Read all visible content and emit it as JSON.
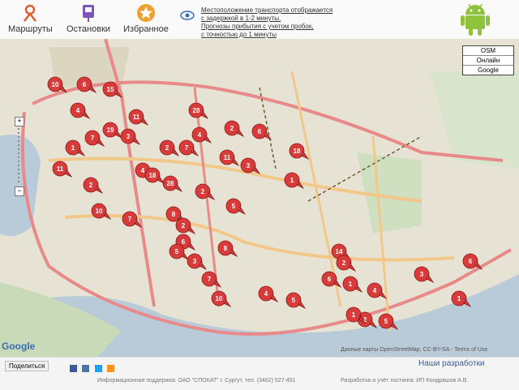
{
  "nav": {
    "routes": "Маршруты",
    "stops": "Остановки",
    "favorites": "Избранное"
  },
  "notice": {
    "line1": "Местоположение транспорта отображается",
    "line2": "с задержкой в 1-2 минуты.",
    "line3": "Прогнозы прибытия с учетом пробок,",
    "line4": "с точностью до 1 минуты"
  },
  "layers": [
    "OSM",
    "Онлайн",
    "Google"
  ],
  "map": {
    "markers": [
      "10",
      "6",
      "15",
      "4",
      "11",
      "28",
      "2",
      "1",
      "7",
      "19",
      "3",
      "2",
      "7",
      "4",
      "6",
      "11",
      "3",
      "18",
      "11",
      "2",
      "4",
      "28",
      "2",
      "18",
      "1",
      "10",
      "7",
      "8",
      "2",
      "6",
      "5",
      "3",
      "7",
      "10",
      "4",
      "5",
      "6",
      "1",
      "4",
      "14",
      "2",
      "5",
      "2",
      "1",
      "3",
      "6",
      "1",
      "5",
      "8"
    ]
  },
  "branding": {
    "google": "Google"
  },
  "attribution": "Данные карты OpenStreetMap, CC-BY-SA - Terms of Use",
  "footer": {
    "share": "Поделиться",
    "dev_link": "Наши разработки",
    "info": "Информационная поддержка: ОАО \"СПОКАТ\" г. Сургут, тел. (3462) 527-451",
    "developers": "Разработка и учёт хостинга: ИП Кондрашов А.В."
  }
}
